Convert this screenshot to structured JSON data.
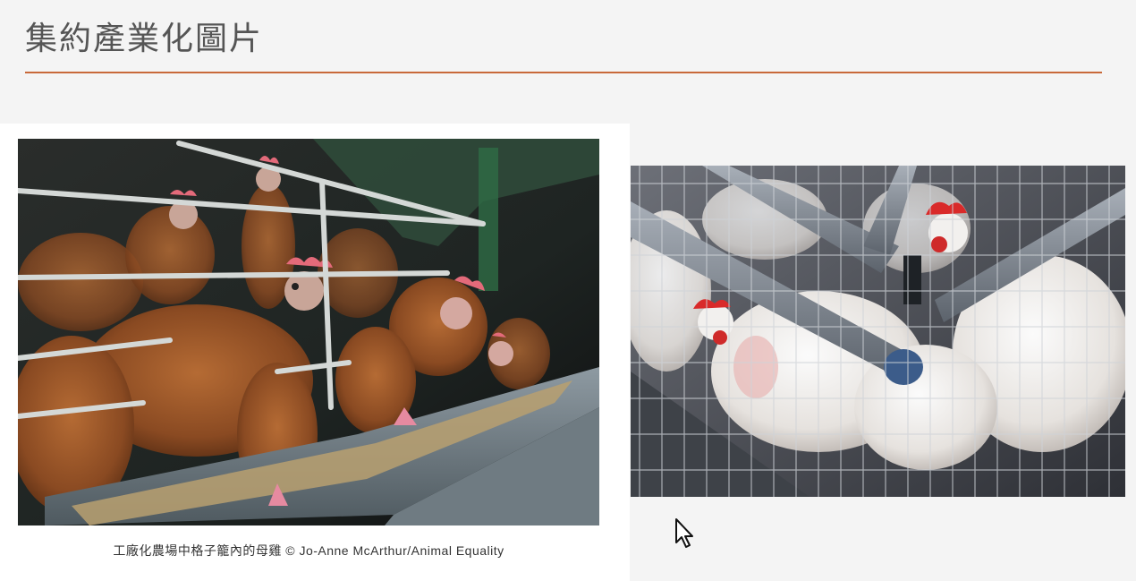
{
  "slide": {
    "title": "集約產業化圖片",
    "accent_color": "#c8693a",
    "left_image": {
      "alt": "hens-in-battery-cage-icon",
      "caption": "工廠化農場中格子籠內的母雞 © Jo-Anne McArthur/Animal Equality"
    },
    "right_image": {
      "alt": "white-hens-in-wire-cage-icon"
    },
    "cursor_icon": "arrow-cursor-icon"
  }
}
